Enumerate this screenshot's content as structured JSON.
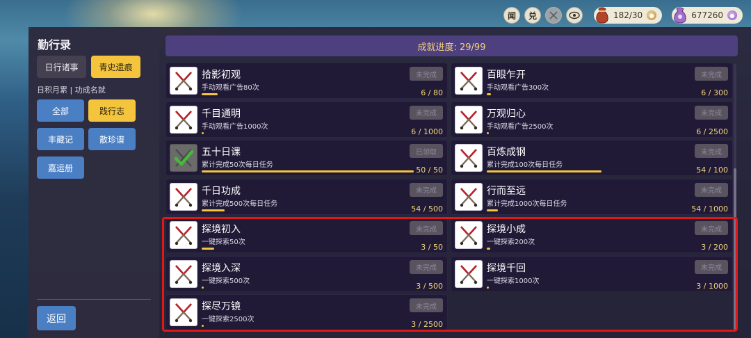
{
  "topbar": {
    "buttons": [
      {
        "label": "闻",
        "name": "news-button",
        "dim": false
      },
      {
        "label": "兑",
        "name": "exchange-button",
        "dim": false
      },
      {
        "label": "",
        "name": "crossed-swords-button",
        "dim": true
      },
      {
        "label": "",
        "name": "eye-button",
        "dim": false
      }
    ],
    "stamina": {
      "value": "182/30",
      "icon": "money-bag-icon"
    },
    "currency": {
      "value": "677260",
      "icon": "gem-pouch-icon"
    }
  },
  "sidebar": {
    "title": "勤行录",
    "tabs": [
      {
        "label": "日行诸事",
        "active": false
      },
      {
        "label": "青史遗痕",
        "active": true
      }
    ],
    "subheading": "日积月累 | 功成名就",
    "categories": [
      {
        "label": "全部",
        "active": false
      },
      {
        "label": "践行志",
        "active": true
      },
      {
        "label": "丰藏记",
        "active": false
      },
      {
        "label": "散珍谱",
        "active": false
      },
      {
        "label": "嘉运册",
        "active": false
      }
    ],
    "back_label": "返回"
  },
  "progress": {
    "text": "成就进度: 29/99"
  },
  "achievements": [
    {
      "name": "拾影初观",
      "desc": "手动观看广告80次",
      "status": "未完成",
      "current": 6,
      "target": 80,
      "count": "6 / 80",
      "done": false
    },
    {
      "name": "百眼乍开",
      "desc": "手动观看广告300次",
      "status": "未完成",
      "current": 6,
      "target": 300,
      "count": "6 / 300",
      "done": false
    },
    {
      "name": "千目通明",
      "desc": "手动观看广告1000次",
      "status": "未完成",
      "current": 6,
      "target": 1000,
      "count": "6 / 1000",
      "done": false
    },
    {
      "name": "万观归心",
      "desc": "手动观看广告2500次",
      "status": "未完成",
      "current": 6,
      "target": 2500,
      "count": "6 / 2500",
      "done": false
    },
    {
      "name": "五十日课",
      "desc": "累计完成50次每日任务",
      "status": "已领取",
      "current": 50,
      "target": 50,
      "count": "50 / 50",
      "done": true
    },
    {
      "name": "百炼成钢",
      "desc": "累计完成100次每日任务",
      "status": "未完成",
      "current": 54,
      "target": 100,
      "count": "54 / 100",
      "done": false
    },
    {
      "name": "千日功成",
      "desc": "累计完成500次每日任务",
      "status": "未完成",
      "current": 54,
      "target": 500,
      "count": "54 / 500",
      "done": false
    },
    {
      "name": "行而至远",
      "desc": "累计完成1000次每日任务",
      "status": "未完成",
      "current": 54,
      "target": 1000,
      "count": "54 / 1000",
      "done": false
    },
    {
      "name": "探境初入",
      "desc": "一键探索50次",
      "status": "未完成",
      "current": 3,
      "target": 50,
      "count": "3 / 50",
      "done": false
    },
    {
      "name": "探境小成",
      "desc": "一键探索200次",
      "status": "未完成",
      "current": 3,
      "target": 200,
      "count": "3 / 200",
      "done": false
    },
    {
      "name": "探境入深",
      "desc": "一键探索500次",
      "status": "未完成",
      "current": 3,
      "target": 500,
      "count": "3 / 500",
      "done": false
    },
    {
      "name": "探境千回",
      "desc": "一键探索1000次",
      "status": "未完成",
      "current": 3,
      "target": 1000,
      "count": "3 / 1000",
      "done": false
    },
    {
      "name": "探尽万镜",
      "desc": "一键探索2500次",
      "status": "未完成",
      "current": 3,
      "target": 2500,
      "count": "3 / 2500",
      "done": false
    }
  ],
  "colors": {
    "accent": "#f4c53c",
    "button_blue": "#4b7fc4",
    "highlight_border": "#e01818",
    "progress_bg": "#4e3f7f"
  }
}
